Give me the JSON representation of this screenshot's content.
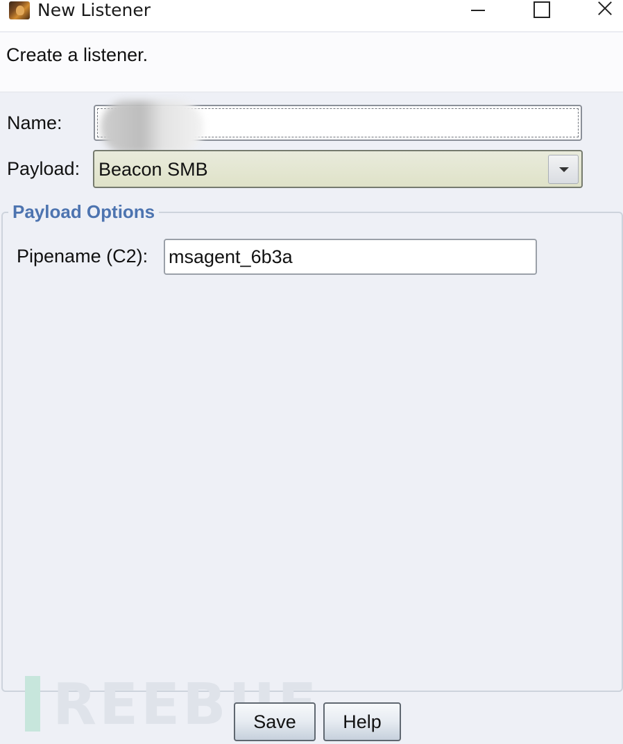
{
  "window": {
    "title": "New Listener",
    "icon": "app-logo-icon"
  },
  "description": "Create a listener.",
  "form": {
    "name_label": "Name:",
    "name_value": "",
    "payload_label": "Payload:",
    "payload_value": "Beacon SMB"
  },
  "payload_options": {
    "title": "Payload Options",
    "pipename_label": "Pipename (C2):",
    "pipename_value": "msagent_6b3a"
  },
  "buttons": {
    "save": "Save",
    "help": "Help"
  },
  "watermark": "REEBUF",
  "colors": {
    "group_title": "#4d74b0",
    "select_bg": "#e3e6cf",
    "window_bg": "#eef0f6"
  }
}
